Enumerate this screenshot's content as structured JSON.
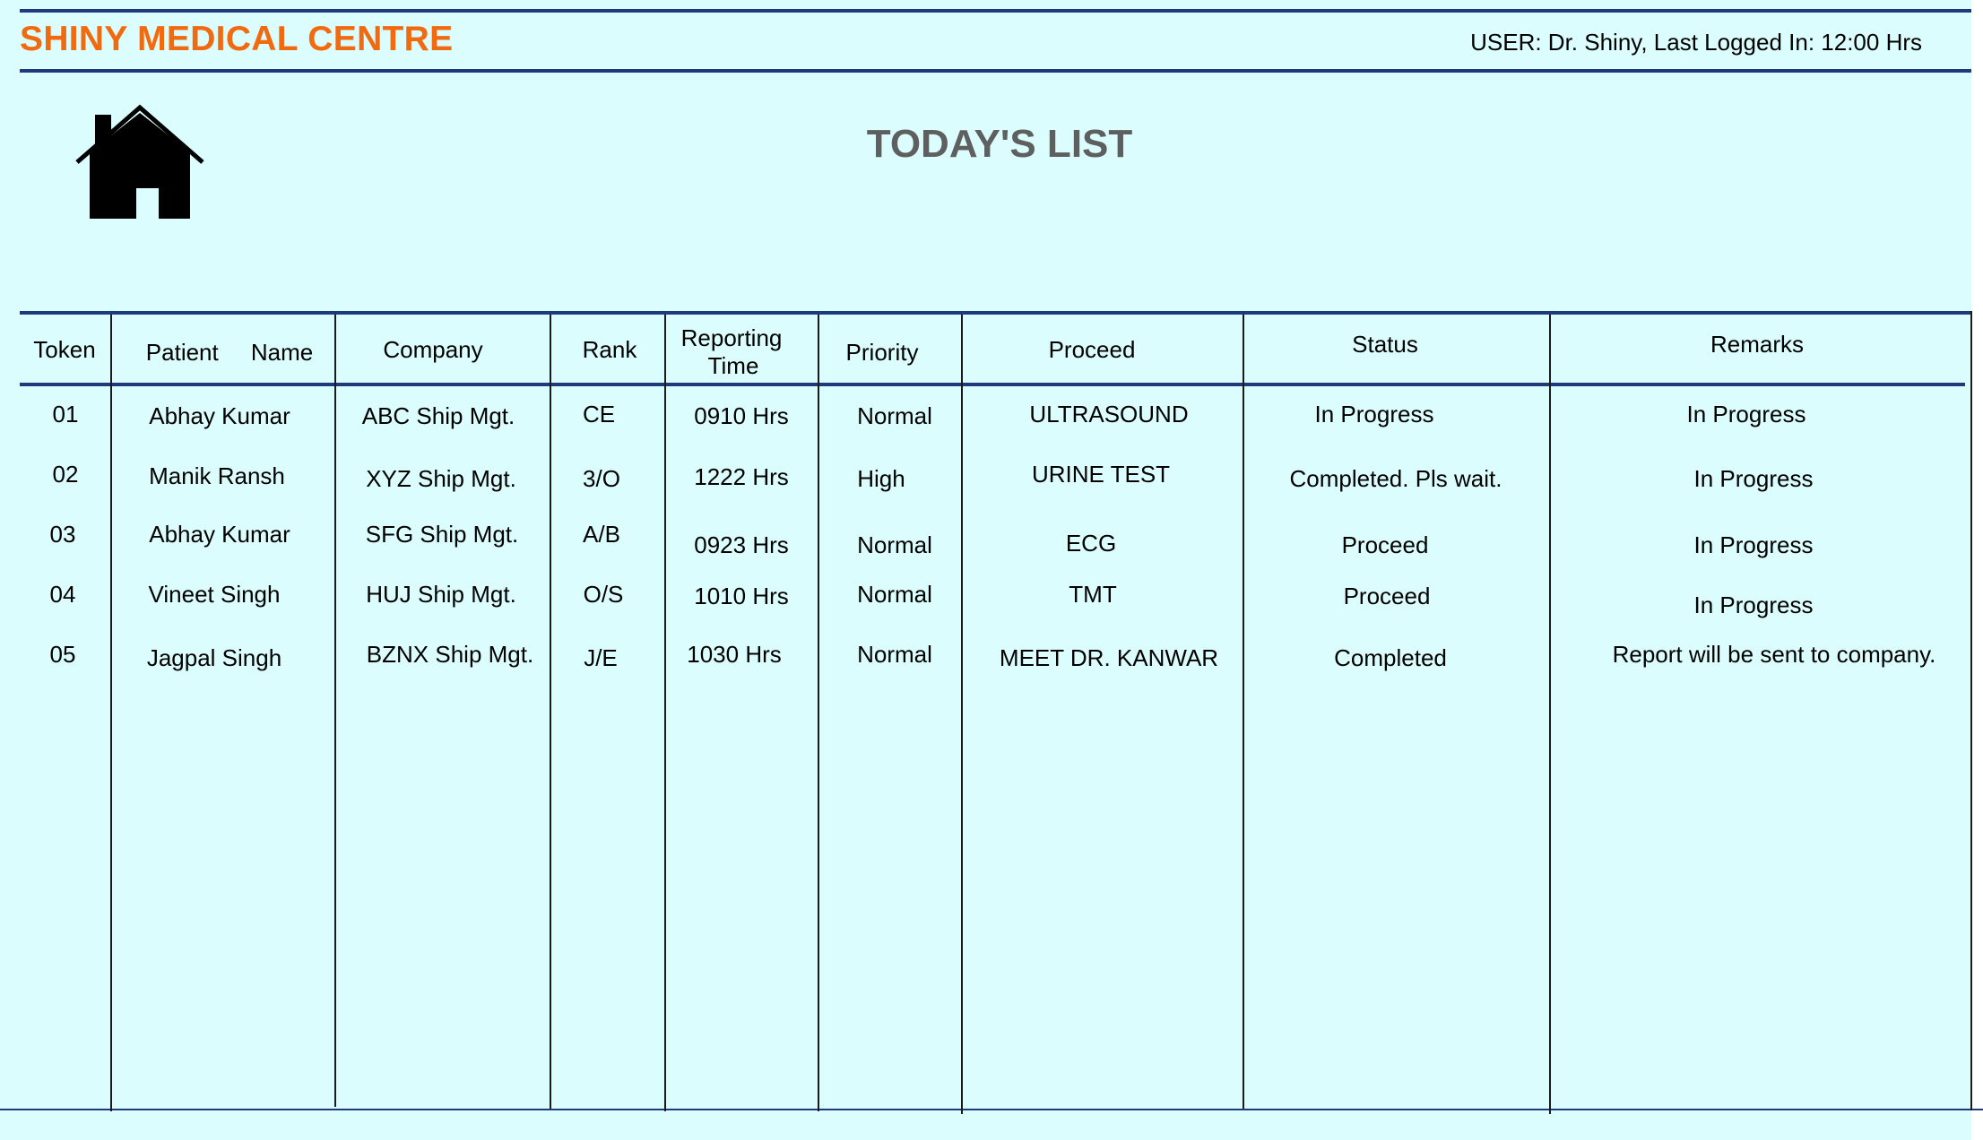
{
  "header": {
    "app_title": "SHINY MEDICAL CENTRE",
    "user_info": "USER: Dr. Shiny, Last Logged In: 12:00 Hrs"
  },
  "page": {
    "title": "TODAY'S LIST",
    "home_icon": "home-icon"
  },
  "table": {
    "columns": {
      "token": "Token",
      "patient_name": "Patient     Name",
      "company": "Company",
      "rank": "Rank",
      "reporting_time_line1": "Reporting",
      "reporting_time_line2": "Time",
      "priority": "Priority",
      "proceed": "Proceed",
      "status": "Status",
      "remarks": "Remarks"
    },
    "rows": [
      {
        "token": "01",
        "patient_name": "Abhay Kumar",
        "company": "ABC Ship Mgt.",
        "rank": "CE",
        "reporting_time": "0910 Hrs",
        "priority": "Normal",
        "proceed": "ULTRASOUND",
        "status": "In Progress",
        "remarks": "In Progress"
      },
      {
        "token": "02",
        "patient_name": "Manik Ransh",
        "company": "XYZ Ship Mgt.",
        "rank": "3/O",
        "reporting_time": "1222 Hrs",
        "priority": "High",
        "proceed": "URINE TEST",
        "status": "Completed. Pls wait.",
        "remarks": "In Progress"
      },
      {
        "token": "03",
        "patient_name": "Abhay Kumar",
        "company": "SFG Ship Mgt.",
        "rank": "A/B",
        "reporting_time": "0923 Hrs",
        "priority": "Normal",
        "proceed": "ECG",
        "status": "Proceed",
        "remarks": "In Progress"
      },
      {
        "token": "04",
        "patient_name": "Vineet Singh",
        "company": "HUJ Ship Mgt.",
        "rank": "O/S",
        "reporting_time": "1010 Hrs",
        "priority": "Normal",
        "proceed": "TMT",
        "status": "Proceed",
        "remarks": "In Progress"
      },
      {
        "token": "05",
        "patient_name": "Jagpal Singh",
        "company": "BZNX Ship Mgt.",
        "rank": "J/E",
        "reporting_time": "1030 Hrs",
        "priority": "Normal",
        "proceed": "MEET DR. KANWAR",
        "status": "Completed",
        "remarks": "Report will be sent to company."
      }
    ]
  }
}
